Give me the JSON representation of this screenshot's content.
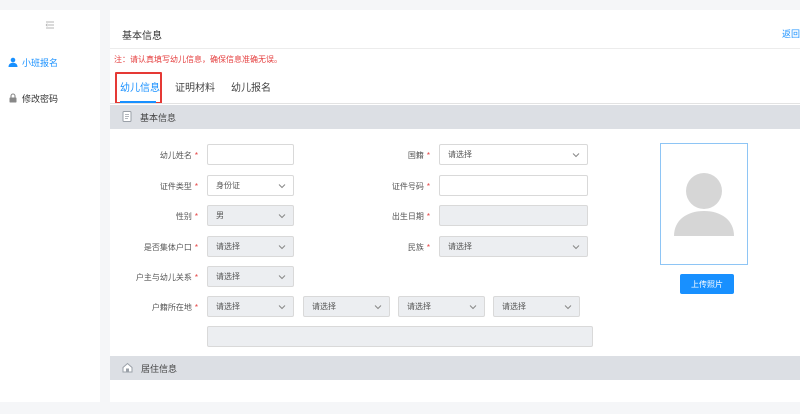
{
  "sidebar": {
    "items": [
      {
        "label": "小班报名",
        "icon": "user-icon",
        "active": true
      },
      {
        "label": "修改密码",
        "icon": "lock-icon",
        "active": false
      }
    ]
  },
  "header": {
    "title": "基本信息",
    "back_link": "返回"
  },
  "notice": "注：请认真填写幼儿信息，确保信息准确无误。",
  "tabs": [
    {
      "label": "幼儿信息",
      "active": true
    },
    {
      "label": "证明材料",
      "active": false
    },
    {
      "label": "幼儿报名",
      "active": false
    }
  ],
  "sections": {
    "basic": "基本信息",
    "residence": "居住信息"
  },
  "form": {
    "child_name": {
      "label": "幼儿姓名",
      "value": ""
    },
    "id_type": {
      "label": "证件类型",
      "value": "身份证"
    },
    "gender": {
      "label": "性别",
      "value": "男"
    },
    "collective_hukou": {
      "label": "是否集体户口",
      "value": "请选择"
    },
    "head_relation": {
      "label": "户主与幼儿关系",
      "value": "请选择"
    },
    "hukou_location": {
      "label": "户籍所在地",
      "province": "请选择",
      "city": "请选择",
      "district": "请选择",
      "street": "请选择",
      "detail": ""
    },
    "nationality": {
      "label": "国籍",
      "value": "请选择"
    },
    "id_number": {
      "label": "证件号码",
      "value": ""
    },
    "birth_date": {
      "label": "出生日期",
      "value": ""
    },
    "ethnicity": {
      "label": "民族",
      "value": "请选择"
    }
  },
  "photo": {
    "upload_label": "上传照片"
  },
  "colors": {
    "accent": "#1890ff",
    "required": "#e53e3e",
    "section_bg": "#dcdfe4",
    "highlight": "#e53935"
  }
}
